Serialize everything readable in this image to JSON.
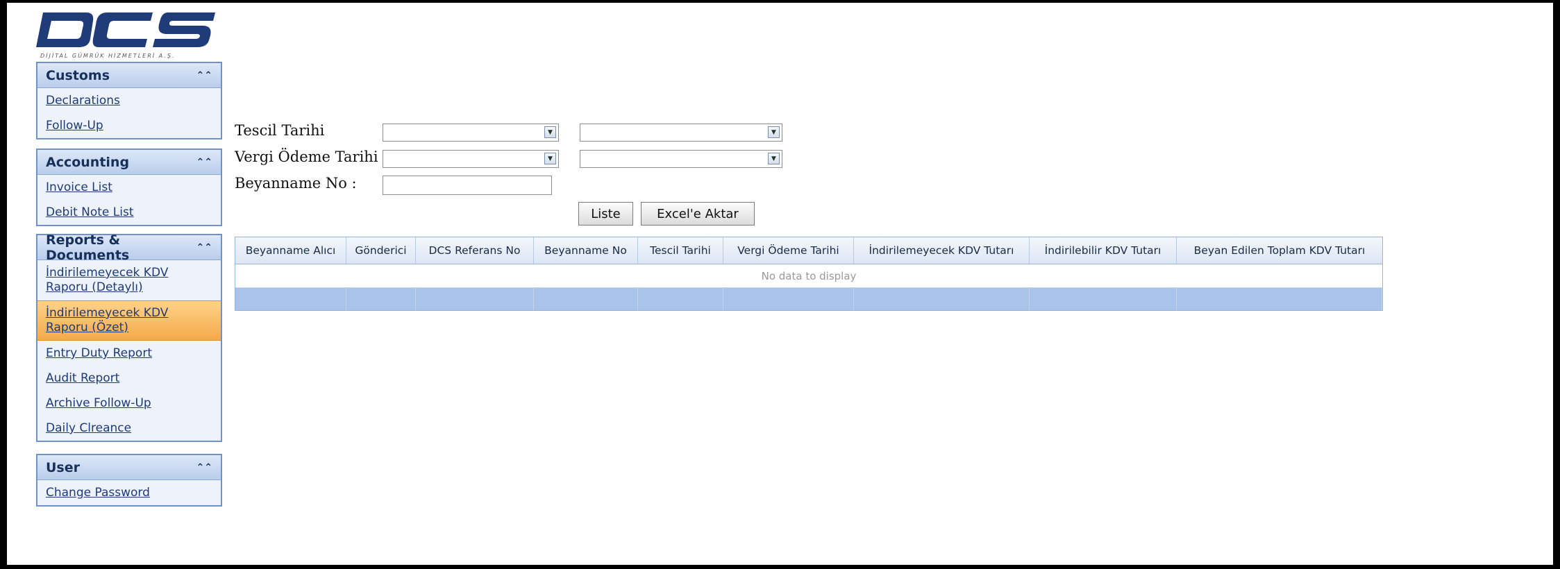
{
  "logo": {
    "text": "DCS",
    "tagline": "DİJİTAL GÜMRÜK HİZMETLERİ A.Ş."
  },
  "sidebar": {
    "panels": [
      {
        "title": "Customs",
        "items": [
          "Declarations",
          "Follow-Up"
        ]
      },
      {
        "title": "Accounting",
        "items": [
          "Invoice List",
          "Debit Note List"
        ]
      },
      {
        "title": "Reports & Documents",
        "items": [
          "İndirilemeyecek KDV Raporu (Detaylı)",
          "İndirilemeyecek KDV Raporu (Özet)",
          "Entry Duty Report",
          "Audit Report",
          "Archive Follow-Up",
          "Daily Clreance"
        ]
      },
      {
        "title": "User",
        "items": [
          "Change Password"
        ]
      }
    ],
    "active_item": "İndirilemeyecek KDV Raporu (Özet)"
  },
  "form": {
    "tescil_label": "Tescil Tarihi",
    "vergi_label": "Vergi Ödeme Tarihi",
    "beyanname_label": "Beyanname No :",
    "tescil_from": "",
    "tescil_to": "",
    "vergi_from": "",
    "vergi_to": "",
    "beyanname_value": "",
    "list_button": "Liste",
    "excel_button": "Excel'e Aktar"
  },
  "grid": {
    "columns": [
      "Beyanname Alıcı",
      "Gönderici",
      "DCS Referans No",
      "Beyanname No",
      "Tescil Tarihi",
      "Vergi Ödeme Tarihi",
      "İndirilemeyecek KDV Tutarı",
      "İndirilebilir KDV Tutarı",
      "Beyan Edilen Toplam KDV Tutarı"
    ],
    "empty_text": "No data to display"
  },
  "colors": {
    "accent": "#b9cdec",
    "active": "#f5a94a",
    "footer": "#a9c3ea"
  }
}
